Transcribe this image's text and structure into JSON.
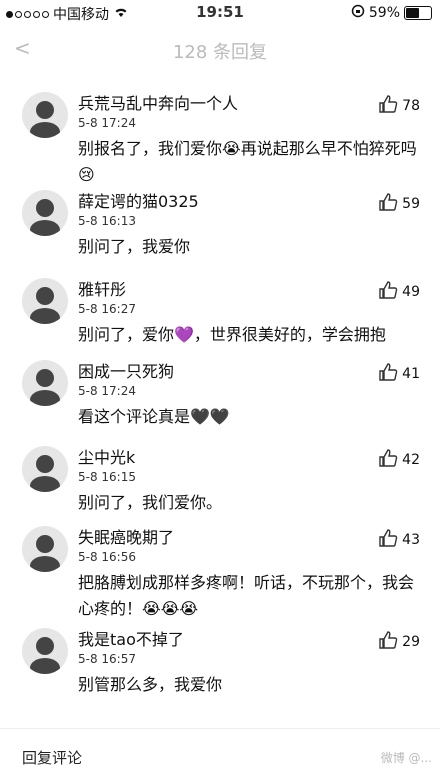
{
  "status_bar": {
    "carrier": "中国移动",
    "time": "19:51",
    "battery": "59%",
    "battery_level": 0.59
  },
  "nav": {
    "back_label": "<",
    "title": "128 条回复"
  },
  "comments": [
    {
      "name": "兵荒马乱中奔向一个人",
      "time": "5-8 17:24",
      "likes": "78",
      "text": "别报名了，我们爱你😭再说起那么早不怕猝死吗😢"
    },
    {
      "name": "薛定谔的猫0325",
      "time": "5-8 16:13",
      "likes": "59",
      "text": "别问了，我爱你"
    },
    {
      "name": "雅轩彤",
      "time": "5-8 16:27",
      "likes": "49",
      "text": "别问了，爱你💜，世界很美好的，学会拥抱"
    },
    {
      "name": "困成一只死狗",
      "time": "5-8 17:24",
      "likes": "41",
      "text": "看这个评论真是🖤🖤"
    },
    {
      "name": "尘中光k",
      "time": "5-8 16:15",
      "likes": "42",
      "text": "别问了，我们爱你。"
    },
    {
      "name": "失眠癌晚期了",
      "time": "5-8 16:56",
      "likes": "43",
      "text": "把胳膊划成那样多疼啊！听话，不玩那个，我会心疼的！😭😭😭"
    },
    {
      "name": "我是tao不掉了",
      "time": "5-8 16:57",
      "likes": "29",
      "text": "别管那么多，我爱你"
    }
  ],
  "footer": {
    "reply_label": "回复评论",
    "watermark": "微博 @..."
  }
}
